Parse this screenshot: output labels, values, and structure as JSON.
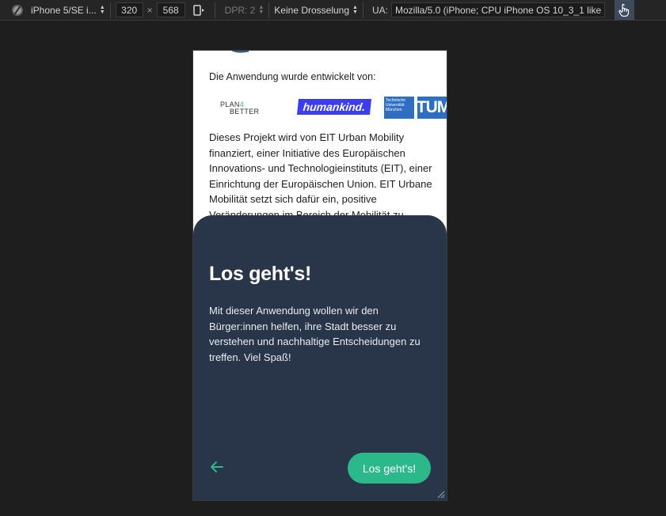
{
  "toolbar": {
    "device_name": "iPhone 5/SE i...",
    "width": "320",
    "times": "×",
    "height": "568",
    "dpr": "DPR: 2",
    "throttling": "Keine Drosselung",
    "ua_label": "UA:",
    "ua_value": "Mozilla/5.0 (iPhone; CPU iPhone OS 10_3_1 like Ma"
  },
  "page": {
    "developed_by": "Die Anwendung wurde entwickelt von:",
    "logos": {
      "plan4better_l1": "PLAN",
      "plan4better_four": "4",
      "plan4better_l2": "BETTER",
      "humankind": "humankind.",
      "tum_text": "Technische Universität München",
      "tum_mark": "TUM"
    },
    "paragraph": "Dieses Projekt wird von EIT Urban Mobility finanziert, einer Initiative des Europäischen Innovations- und Technologieinstituts (EIT), einer Einrichtung der Europäischen Union. EIT Urbane Mobilität setzt sich dafür ein, positive Veränderungen im Bereich der Mobilität zu"
  },
  "sheet": {
    "title": "Los geht's!",
    "text": "Mit dieser Anwendung wollen wir den Bürger:innen helfen, ihre Stadt besser zu verstehen und nachhaltige Entscheidungen zu treffen. Viel Spaß!",
    "button_label": "Los geht's!"
  },
  "colors": {
    "accent": "#2bb88a",
    "sheet_bg": "#293548",
    "humankind_bg": "#3d3df0",
    "tum_blue": "#2f6fc1"
  }
}
